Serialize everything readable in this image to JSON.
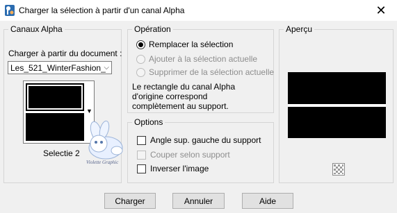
{
  "window": {
    "title": "Charger la sélection à partir d'un canal Alpha",
    "app_icon": "paintshop-icon",
    "close_glyph": "✕"
  },
  "channels": {
    "group_label": "Canaux Alpha",
    "load_from_label": "Charger à partir du document :",
    "document_value": "Les_521_WinterFashion_",
    "dropdown_arrow": "⌵",
    "list_arrow": "▼",
    "selection_caption": "Selectie 2",
    "watermark": "Violette Graphic"
  },
  "operation": {
    "group_label": "Opération",
    "options": [
      {
        "label": "Remplacer la sélection",
        "checked": true,
        "enabled": true
      },
      {
        "label": "Ajouter à la sélection actuelle",
        "checked": false,
        "enabled": false
      },
      {
        "label": "Supprimer de la sélection actuelle",
        "checked": false,
        "enabled": false
      }
    ],
    "info_line1": "Le rectangle du canal Alpha",
    "info_line2": "d'origine correspond",
    "info_line3": "complètement au support."
  },
  "options": {
    "group_label": "Options",
    "items": [
      {
        "label": "Angle sup. gauche du support",
        "checked": false,
        "enabled": true
      },
      {
        "label": "Couper selon support",
        "checked": false,
        "enabled": false
      },
      {
        "label": "Inverser l'image",
        "checked": false,
        "enabled": true
      }
    ]
  },
  "preview": {
    "group_label": "Aperçu",
    "zoom_icon": "checker-zoom-icon"
  },
  "buttons": {
    "load": "Charger",
    "cancel": "Annuler",
    "help": "Aide"
  }
}
